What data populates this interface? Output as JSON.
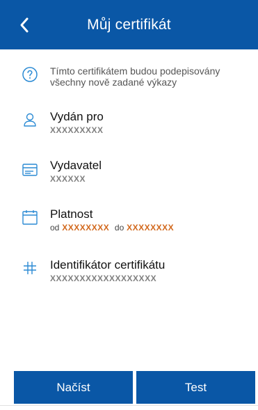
{
  "header": {
    "title": "Můj certifikát",
    "back_icon": "chevron-left-icon"
  },
  "info": {
    "icon": "question-circle-icon",
    "text": "Tímto certifikátem budou podepisovány všechny nově zadané výkazy"
  },
  "issued_to": {
    "icon": "user-icon",
    "label": "Vydán pro",
    "value": "XXXXXXXXX"
  },
  "issuer": {
    "icon": "card-icon",
    "label": "Vydavatel",
    "value": "XXXXXX"
  },
  "validity": {
    "icon": "calendar-icon",
    "label": "Platnost",
    "from_prefix": "od",
    "from_value": "XXXXXXXX",
    "to_prefix": "do",
    "to_value": "XXXXXXXX"
  },
  "identifier": {
    "icon": "hash-icon",
    "label": "Identifikátor certifikátu",
    "value": "XXXXXXXXXXXXXXXXXX"
  },
  "buttons": {
    "load_label": "Načíst",
    "test_label": "Test"
  },
  "colors": {
    "primary": "#0a57a6",
    "icon_accent": "#2a8ad4"
  }
}
